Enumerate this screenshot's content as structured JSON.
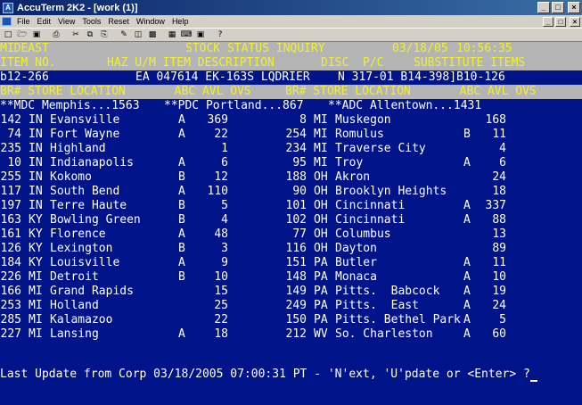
{
  "window": {
    "title": "AccuTerm 2K2 - [work (1)]",
    "app_icon_glyph": "A",
    "buttons": [
      "_",
      "□",
      "×"
    ]
  },
  "menu": [
    "File",
    "Edit",
    "View",
    "Tools",
    "Reset",
    "Window",
    "Help"
  ],
  "toolbar_icons": [
    "new-icon",
    "open-icon",
    "save-icon",
    "print-icon",
    "cut-icon",
    "copy-icon",
    "paste-icon",
    "edit-icon",
    "folder-icon",
    "select-icon",
    "settings-icon",
    "keyboard-icon",
    "monitor-icon",
    "help-icon"
  ],
  "screen": {
    "header1": {
      "left": "MIDEAST",
      "center": "STOCK STATUS INQUIRY",
      "date": "03/18/05",
      "time": "10:56:35"
    },
    "header2": {
      "item_no": "ITEM NO.",
      "haz": "HAZ U/M ITEM DESCRIPTION",
      "disc": "DISC  P/C",
      "subs": "SUBSTITUTE ITEMS"
    },
    "item_line": {
      "item": "b12-266",
      "detail": "EA 047614 EK-163S LQDRIER    N 317-01 B14-398]B10-126"
    },
    "col_header": {
      "left": "BR# STORE LOCATION       ABC AVL OVS",
      "right": "BR# STORE LOCATION       ABC AVL OVS"
    },
    "dc_line": {
      "mdc": "**MDC Memphis...1563",
      "pdc": "**PDC Portland...867",
      "adc": "**ADC Allentown...1431"
    },
    "rows": [
      {
        "l_br": "142",
        "l_st": "IN",
        "l_loc": "Evansville",
        "l_abc": "A",
        "l_avl": "369",
        "r_br": "8",
        "r_st": "MI",
        "r_loc": "Muskegon",
        "r_abc": "",
        "r_avl": "168"
      },
      {
        "l_br": "74",
        "l_st": "IN",
        "l_loc": "Fort Wayne",
        "l_abc": "A",
        "l_avl": "22",
        "r_br": "254",
        "r_st": "MI",
        "r_loc": "Romulus",
        "r_abc": "B",
        "r_avl": "11"
      },
      {
        "l_br": "235",
        "l_st": "IN",
        "l_loc": "Highland",
        "l_abc": "",
        "l_avl": "1",
        "r_br": "234",
        "r_st": "MI",
        "r_loc": "Traverse City",
        "r_abc": "",
        "r_avl": "4"
      },
      {
        "l_br": "10",
        "l_st": "IN",
        "l_loc": "Indianapolis",
        "l_abc": "A",
        "l_avl": "6",
        "r_br": "95",
        "r_st": "MI",
        "r_loc": "Troy",
        "r_abc": "A",
        "r_avl": "6"
      },
      {
        "l_br": "255",
        "l_st": "IN",
        "l_loc": "Kokomo",
        "l_abc": "B",
        "l_avl": "12",
        "r_br": "188",
        "r_st": "OH",
        "r_loc": "Akron",
        "r_abc": "",
        "r_avl": "24"
      },
      {
        "l_br": "117",
        "l_st": "IN",
        "l_loc": "South Bend",
        "l_abc": "A",
        "l_avl": "110",
        "r_br": "90",
        "r_st": "OH",
        "r_loc": "Brooklyn Heights",
        "r_abc": "",
        "r_avl": "18"
      },
      {
        "l_br": "197",
        "l_st": "IN",
        "l_loc": "Terre Haute",
        "l_abc": "B",
        "l_avl": "5",
        "r_br": "101",
        "r_st": "OH",
        "r_loc": "Cincinnati",
        "r_abc": "A",
        "r_avl": "337"
      },
      {
        "l_br": "163",
        "l_st": "KY",
        "l_loc": "Bowling Green",
        "l_abc": "B",
        "l_avl": "4",
        "r_br": "102",
        "r_st": "OH",
        "r_loc": "Cincinnati",
        "r_abc": "A",
        "r_avl": "88"
      },
      {
        "l_br": "161",
        "l_st": "KY",
        "l_loc": "Florence",
        "l_abc": "A",
        "l_avl": "48",
        "r_br": "77",
        "r_st": "OH",
        "r_loc": "Columbus",
        "r_abc": "",
        "r_avl": "13"
      },
      {
        "l_br": "126",
        "l_st": "KY",
        "l_loc": "Lexington",
        "l_abc": "B",
        "l_avl": "3",
        "r_br": "116",
        "r_st": "OH",
        "r_loc": "Dayton",
        "r_abc": "",
        "r_avl": "89"
      },
      {
        "l_br": "184",
        "l_st": "KY",
        "l_loc": "Louisville",
        "l_abc": "A",
        "l_avl": "9",
        "r_br": "151",
        "r_st": "PA",
        "r_loc": "Butler",
        "r_abc": "A",
        "r_avl": "11"
      },
      {
        "l_br": "226",
        "l_st": "MI",
        "l_loc": "Detroit",
        "l_abc": "B",
        "l_avl": "10",
        "r_br": "148",
        "r_st": "PA",
        "r_loc": "Monaca",
        "r_abc": "A",
        "r_avl": "10"
      },
      {
        "l_br": "166",
        "l_st": "MI",
        "l_loc": "Grand Rapids",
        "l_abc": "",
        "l_avl": "15",
        "r_br": "149",
        "r_st": "PA",
        "r_loc": "Pitts.  Babcock",
        "r_abc": "A",
        "r_avl": "19"
      },
      {
        "l_br": "253",
        "l_st": "MI",
        "l_loc": "Holland",
        "l_abc": "",
        "l_avl": "25",
        "r_br": "249",
        "r_st": "PA",
        "r_loc": "Pitts.  East",
        "r_abc": "A",
        "r_avl": "24"
      },
      {
        "l_br": "285",
        "l_st": "MI",
        "l_loc": "Kalamazoo",
        "l_abc": "",
        "l_avl": "22",
        "r_br": "150",
        "r_st": "PA",
        "r_loc": "Pitts. Bethel Park",
        "r_abc": "A",
        "r_avl": "5"
      },
      {
        "l_br": "227",
        "l_st": "MI",
        "l_loc": "Lansing",
        "l_abc": "A",
        "l_avl": "18",
        "r_br": "212",
        "r_st": "WV",
        "r_loc": "So. Charleston",
        "r_abc": "A",
        "r_avl": "60"
      }
    ],
    "status_line": "Last Update from Corp 03/18/2005 07:00:31 PT - 'N'ext, 'U'pdate or <Enter> ?"
  }
}
